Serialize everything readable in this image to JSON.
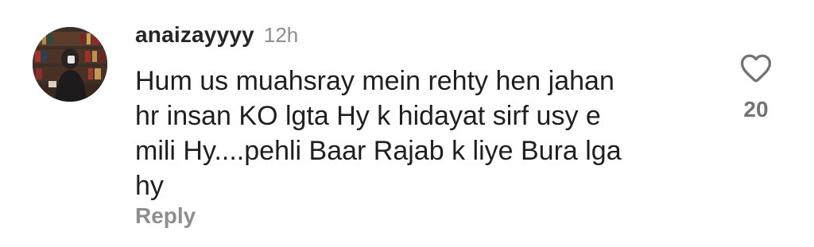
{
  "comment": {
    "username": "anaizayyyy",
    "time": "12h",
    "text": "Hum us muahsray mein rehty hen jahan\nhr insan KO lgta Hy k hidayat sirf usy e\nmili Hy....pehli Baar Rajab k liye Bura lga\nhy",
    "reply_label": "Reply",
    "like_count": "20"
  },
  "icons": {
    "like": "heart-outline-icon"
  },
  "colors": {
    "username": "#262626",
    "muted": "#8e8e8e",
    "text": "#1f1f1f"
  }
}
